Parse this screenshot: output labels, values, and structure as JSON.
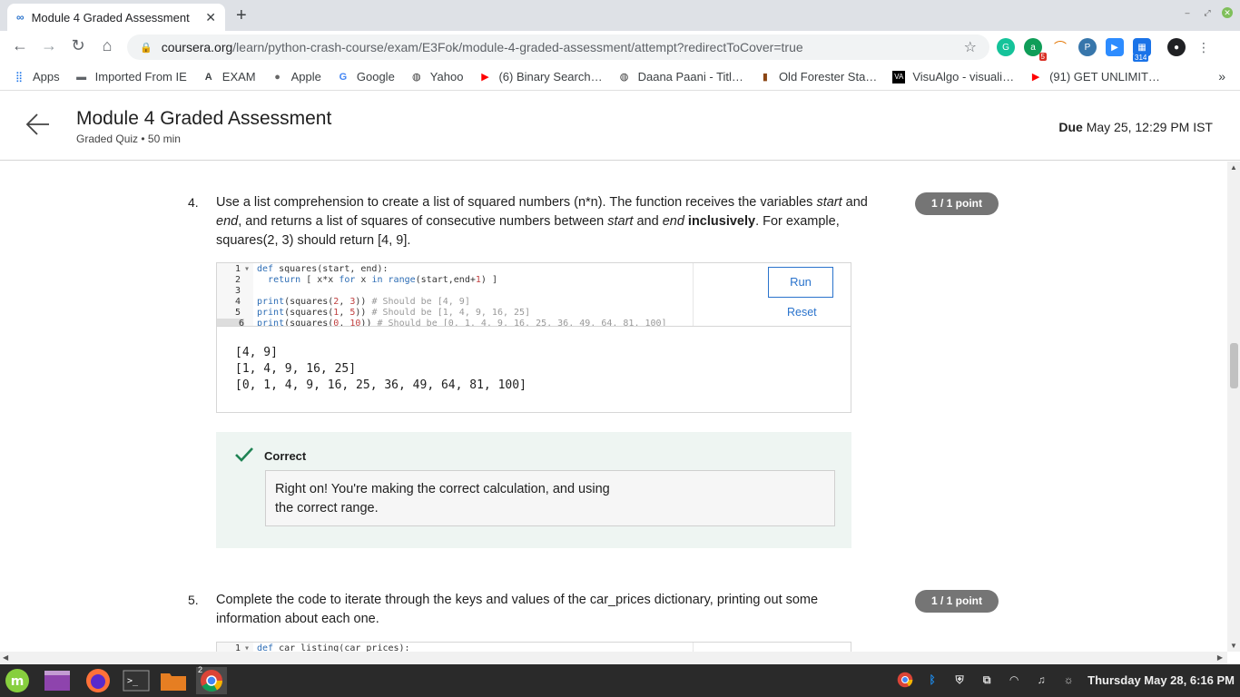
{
  "browser": {
    "tab_title": "Module 4 Graded Assessment",
    "new_tab": "+",
    "url_host": "coursera.org",
    "url_path": "/learn/python-crash-course/exam/E3Fok/module-4-graded-assessment/attempt?redirectToCover=true",
    "ext_badge_a": "5",
    "ext_badge_calendar": "314"
  },
  "bookmarks": {
    "items": [
      {
        "label": "Apps",
        "icon": "apps-grid-icon"
      },
      {
        "label": "Imported From IE",
        "icon": "folder-icon"
      },
      {
        "label": "EXAM",
        "icon": "a-logo-icon"
      },
      {
        "label": "Apple",
        "icon": "apple-icon"
      },
      {
        "label": "Google",
        "icon": "google-icon"
      },
      {
        "label": "Yahoo",
        "icon": "globe-icon"
      },
      {
        "label": "(6) Binary Search…",
        "icon": "youtube-icon"
      },
      {
        "label": "Daana Paani - Titl…",
        "icon": "globe-icon"
      },
      {
        "label": "Old Forester Sta…",
        "icon": "bottle-icon"
      },
      {
        "label": "VisuAlgo - visuali…",
        "icon": "va-icon"
      },
      {
        "label": "(91) GET UNLIMIT…",
        "icon": "youtube-icon"
      }
    ],
    "more": "»"
  },
  "page": {
    "title": "Module 4 Graded Assessment",
    "subtitle": "Graded Quiz • 50 min",
    "due_label": "Due",
    "due_value": "May 25, 12:29 PM IST"
  },
  "q4": {
    "number": "4.",
    "points": "1 / 1 point",
    "run_label": "Run",
    "reset_label": "Reset",
    "code_lines": [
      {
        "n": "1",
        "text": "def squares(start, end):"
      },
      {
        "n": "2",
        "text": "  return [ x*x for x in range(start,end+1) ]"
      },
      {
        "n": "3",
        "text": ""
      },
      {
        "n": "4",
        "text": "print(squares(2, 3)) # Should be [4, 9]"
      },
      {
        "n": "5",
        "text": "print(squares(1, 5)) # Should be [1, 4, 9, 16, 25]"
      },
      {
        "n": "6",
        "text": "print(squares(0, 10)) # Should be [0, 1, 4, 9, 16, 25, 36, 49, 64, 81, 100]"
      }
    ],
    "output": [
      "[4, 9]",
      "[1, 4, 9, 16, 25]",
      "[0, 1, 4, 9, 16, 25, 36, 49, 64, 81, 100]"
    ],
    "feedback_status": "Correct",
    "feedback_line1": "Right on! You're making the correct calculation, and using",
    "feedback_line2": "the correct range."
  },
  "q5": {
    "number": "5.",
    "points": "1 / 1 point",
    "text_line1": "Complete the code to iterate through the keys and values of the car_prices dictionary, printing out some",
    "text_line2": "information about each one.",
    "code_first_line_n": "1",
    "code_first_line": "def car_listing(car_prices):"
  },
  "taskbar": {
    "datetime": "Thursday May 28,  6:16 PM",
    "chrome_window_count": "2"
  },
  "colors": {
    "link_blue": "#2a73cc",
    "success_green": "#1f8354",
    "points_pill": "#757575",
    "feedback_bg": "#eef5f2"
  }
}
